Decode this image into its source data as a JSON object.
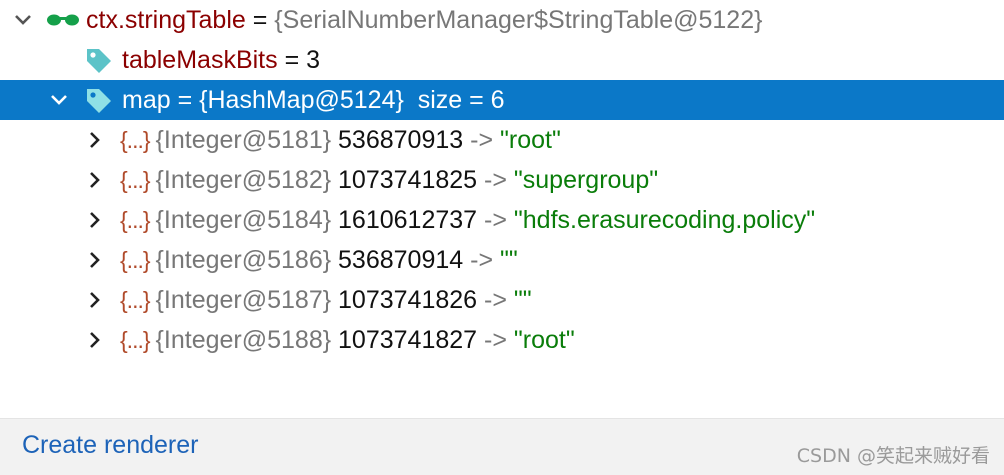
{
  "tree": {
    "root": {
      "name": "ctx.stringTable",
      "eq": " = ",
      "type": "{SerialNumberManager$StringTable@5122}"
    },
    "mask_bits": {
      "name": "tableMaskBits",
      "eq": " = ",
      "value": "3"
    },
    "map": {
      "name": "map",
      "eq": " = ",
      "type": "{HashMap@5124}",
      "size": "  size = 6"
    },
    "entries": [
      {
        "icon": "{...}",
        "type": "{Integer@5181}",
        "key": " 536870913",
        "arrow": " -> ",
        "value": "\"root\""
      },
      {
        "icon": "{...}",
        "type": "{Integer@5182}",
        "key": " 1073741825",
        "arrow": " -> ",
        "value": "\"supergroup\""
      },
      {
        "icon": "{...}",
        "type": "{Integer@5184}",
        "key": " 1610612737",
        "arrow": " -> ",
        "value": "\"hdfs.erasurecoding.policy\""
      },
      {
        "icon": "{...}",
        "type": "{Integer@5186}",
        "key": " 536870914",
        "arrow": " -> ",
        "value": "\"\""
      },
      {
        "icon": "{...}",
        "type": "{Integer@5187}",
        "key": " 1073741826",
        "arrow": " -> ",
        "value": "\"\""
      },
      {
        "icon": "{...}",
        "type": "{Integer@5188}",
        "key": " 1073741827",
        "arrow": " -> ",
        "value": "\"root\""
      }
    ]
  },
  "footer": {
    "create_renderer": "Create renderer",
    "watermark": "CSDN @笑起来贼好看"
  },
  "colors": {
    "selection": "#0b78c8",
    "var_name": "#8b0000",
    "string_value": "#0a7d0a",
    "link": "#1d63b8"
  },
  "icons": {
    "root": "glasses-icon",
    "field": "tag-icon",
    "entry": "braces-icon",
    "expanded": "chevron-down-icon",
    "collapsed": "chevron-right-icon"
  }
}
